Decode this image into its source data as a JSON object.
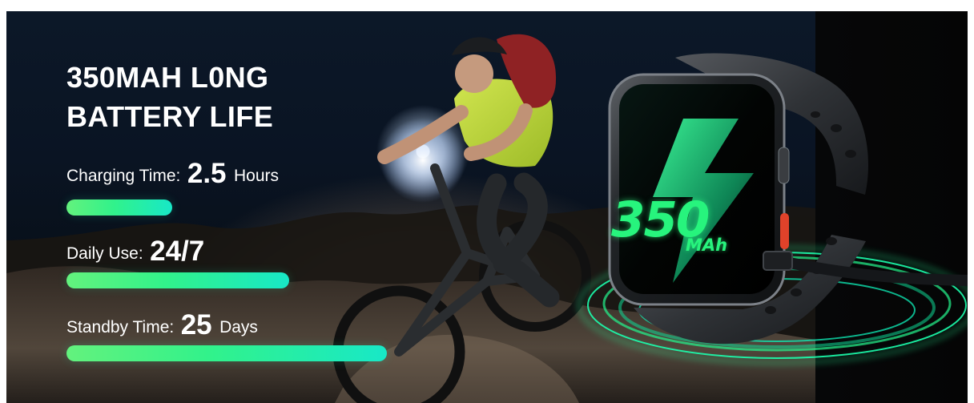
{
  "headline": {
    "line1": "350MAH L0NG",
    "line2": "BATTERY LIFE"
  },
  "stats": [
    {
      "label": "Charging Time:",
      "value": "2.5",
      "unit": "Hours",
      "bar_fraction": 0.33
    },
    {
      "label": "Daily Use:",
      "value": "24/7",
      "unit": "",
      "bar_fraction": 0.69
    },
    {
      "label": "Standby Time:",
      "value": "25",
      "unit": "Days",
      "bar_fraction": 1.0
    }
  ],
  "watch_display": {
    "value": "350",
    "unit": "MAh"
  },
  "colors": {
    "accent_green": "#63f27d",
    "accent_teal": "#18e8c7",
    "display_green": "#27f47d",
    "background": "#0a1423"
  },
  "icons": {
    "display_icon": "lightning-bolt-icon"
  }
}
